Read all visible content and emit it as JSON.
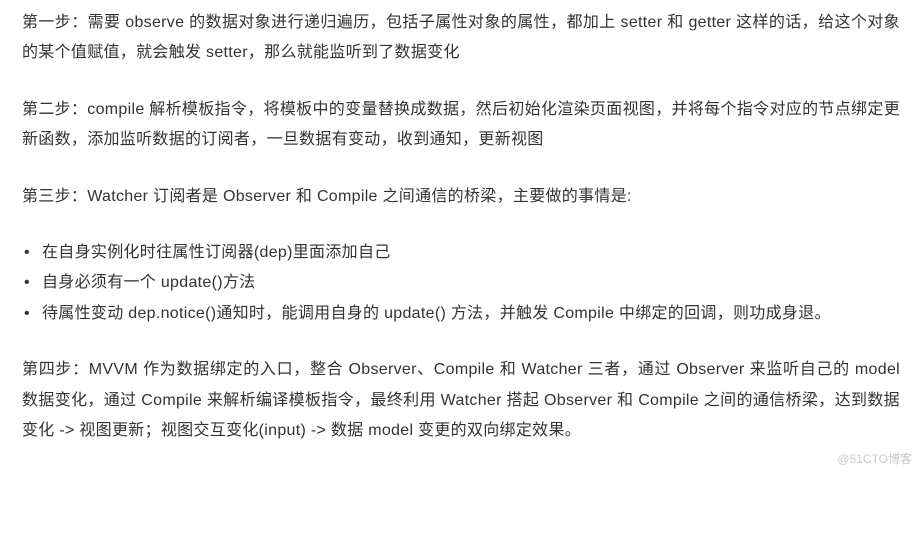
{
  "paragraphs": {
    "step1": "第一步：需要 observe 的数据对象进行递归遍历，包括子属性对象的属性，都加上 setter 和 getter 这样的话，给这个对象的某个值赋值，就会触发 setter，那么就能监听到了数据变化",
    "step2": "第二步：compile 解析模板指令，将模板中的变量替换成数据，然后初始化渲染页面视图，并将每个指令对应的节点绑定更新函数，添加监听数据的订阅者，一旦数据有变动，收到通知，更新视图",
    "step3_intro": "第三步：Watcher 订阅者是 Observer 和 Compile 之间通信的桥梁，主要做的事情是:",
    "step4": "第四步：MVVM 作为数据绑定的入口，整合 Observer、Compile 和 Watcher 三者，通过 Observer 来监听自己的 model 数据变化，通过 Compile 来解析编译模板指令，最终利用 Watcher 搭起 Observer 和 Compile 之间的通信桥梁，达到数据变化 -> 视图更新；视图交互变化(input) -> 数据 model 变更的双向绑定效果。"
  },
  "bullets": [
    "在自身实例化时往属性订阅器(dep)里面添加自己",
    "自身必须有一个 update()方法",
    "待属性变动 dep.notice()通知时，能调用自身的 update() 方法，并触发 Compile 中绑定的回调，则功成身退。"
  ],
  "watermark": "@51CTO博客"
}
